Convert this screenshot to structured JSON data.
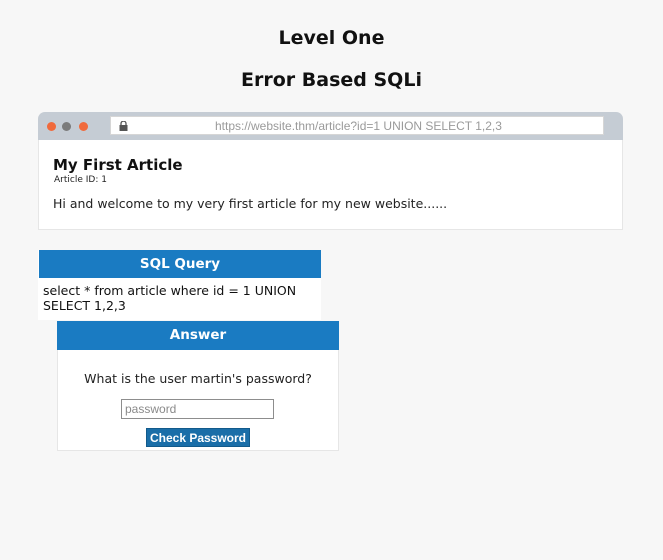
{
  "page": {
    "level_title": "Level One",
    "subtitle": "Error Based SQLi"
  },
  "browser": {
    "url": "https://website.thm/article?id=1 UNION SELECT 1,2,3",
    "article": {
      "title": "My First Article",
      "id_label": "Article ID: 1",
      "body": "Hi and welcome to my very first article for my new website......"
    }
  },
  "sql_query": {
    "header": "SQL Query",
    "text": "select * from article where id = 1 UNION SELECT 1,2,3"
  },
  "answer": {
    "header": "Answer",
    "question": "What is the user martin's password?",
    "placeholder": "password",
    "button_label": "Check Password"
  },
  "colors": {
    "accent": "#1a7bc2",
    "button": "#1a6ea8",
    "traffic_red": "#f06a3c",
    "traffic_gray": "#7b7b7b",
    "browser_bar": "#c5ccd4"
  }
}
